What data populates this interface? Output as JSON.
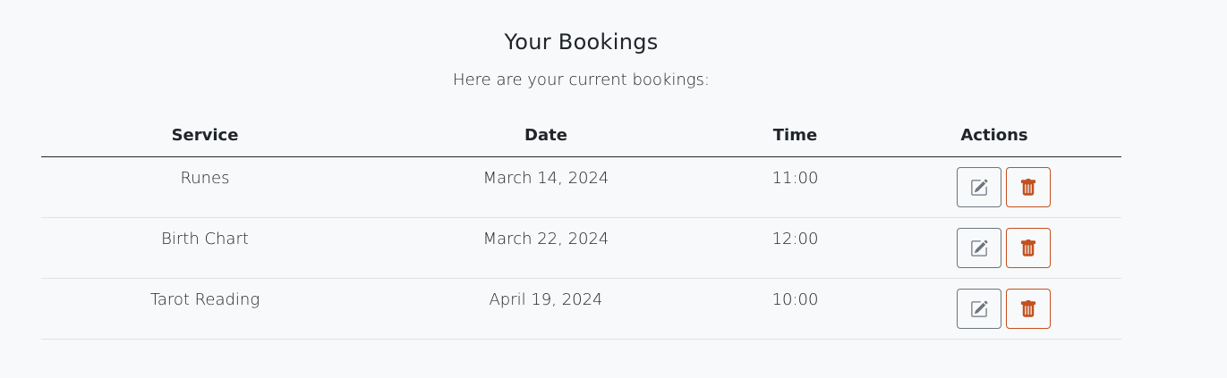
{
  "header": {
    "title": "Your Bookings",
    "subtitle": "Here are your current bookings:"
  },
  "table": {
    "columns": [
      "Service",
      "Date",
      "Time",
      "Actions"
    ],
    "rows": [
      {
        "service": "Runes",
        "date": "March 14, 2024",
        "time": "11:00"
      },
      {
        "service": "Birth Chart",
        "date": "March 22, 2024",
        "time": "12:00"
      },
      {
        "service": "Tarot Reading",
        "date": "April 19, 2024",
        "time": "10:00"
      }
    ]
  },
  "icons": {
    "edit": "pencil-square-icon",
    "delete": "trash-icon"
  },
  "colors": {
    "edit_icon": "#6c757d",
    "delete_icon": "#c4501f",
    "header_rule": "#212529",
    "row_rule": "#dee2e6",
    "background": "#f8f9fb"
  }
}
